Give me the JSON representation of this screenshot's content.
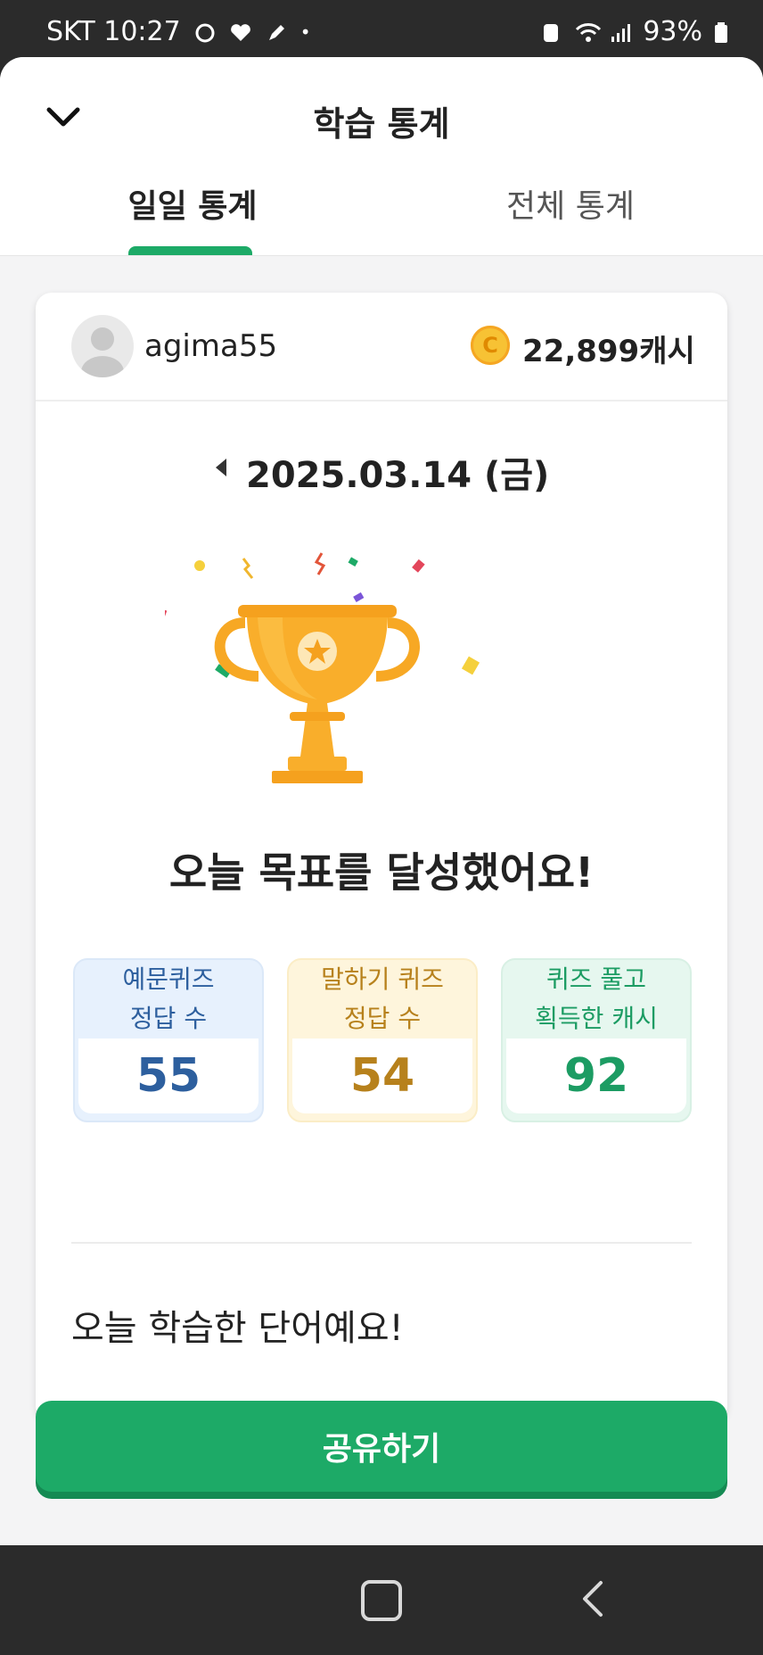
{
  "status_bar": {
    "carrier_time": "SKT 10:27",
    "battery": "93%"
  },
  "header": {
    "title": "학습 통계",
    "tabs": [
      {
        "label": "일일 통계",
        "active": true
      },
      {
        "label": "전체 통계",
        "active": false
      }
    ]
  },
  "profile": {
    "username": "agima55",
    "coin_glyph": "C",
    "cash": "22,899캐시"
  },
  "date": "2025.03.14 (금)",
  "goal_message": "오늘 목표를 달성했어요!",
  "stats": [
    {
      "line1": "예문퀴즈",
      "line2": "정답 수",
      "value": "55",
      "color": "#2d5f9e"
    },
    {
      "line1": "말하기 퀴즈",
      "line2": "정답 수",
      "value": "54",
      "color": "#b7811c"
    },
    {
      "line1": "퀴즈 풀고",
      "line2": "획득한 캐시",
      "value": "92",
      "color": "#1c9c63"
    }
  ],
  "words_section_title": "오늘 학습한 단어예요!",
  "share_button": "공유하기",
  "colors": {
    "accent": "#1daa67",
    "trophy": "#f7a824"
  },
  "icons": [
    "chevron-down-icon",
    "avatar-placeholder-icon",
    "coin-icon",
    "chevron-left-icon",
    "trophy-icon",
    "home-icon",
    "back-icon"
  ]
}
